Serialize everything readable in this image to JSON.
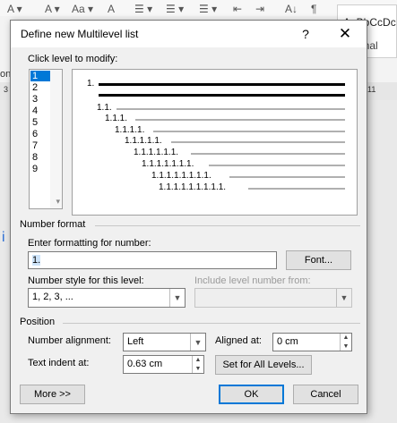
{
  "background": {
    "style_gallery": [
      "AaBbCcDc",
      "Normal"
    ],
    "ruler_left": "3",
    "ruler_right": "11",
    "left_text": "ont"
  },
  "dialog": {
    "title": "Define new Multilevel list",
    "help": "?",
    "close": "✕",
    "click_level_label": "Click level to modify:",
    "levels": [
      "1",
      "2",
      "3",
      "4",
      "5",
      "6",
      "7",
      "8",
      "9"
    ],
    "selected_level": "1",
    "preview": [
      "1.",
      "1.1.",
      "1.1.1.",
      "1.1.1.1.",
      "1.1.1.1.1.",
      "1.1.1.1.1.1.",
      "1.1.1.1.1.1.1.",
      "1.1.1.1.1.1.1.1.",
      "1.1.1.1.1.1.1.1.1."
    ],
    "number_format": {
      "section": "Number format",
      "enter_label": "Enter formatting for number:",
      "format_value": "1.",
      "font_button": "Font...",
      "style_label": "Number style for this level:",
      "style_value": "1, 2, 3, ...",
      "include_label": "Include level number from:",
      "include_value": ""
    },
    "position": {
      "section": "Position",
      "alignment_label": "Number alignment:",
      "alignment_value": "Left",
      "aligned_at_label": "Aligned at:",
      "aligned_at_value": "0 cm",
      "indent_label": "Text indent at:",
      "indent_value": "0.63 cm",
      "set_all_button": "Set for All Levels..."
    },
    "buttons": {
      "more": "More >>",
      "ok": "OK",
      "cancel": "Cancel"
    }
  },
  "colors": {
    "accent": "#0078d7",
    "dialog_bg": "#f0f0f0"
  }
}
